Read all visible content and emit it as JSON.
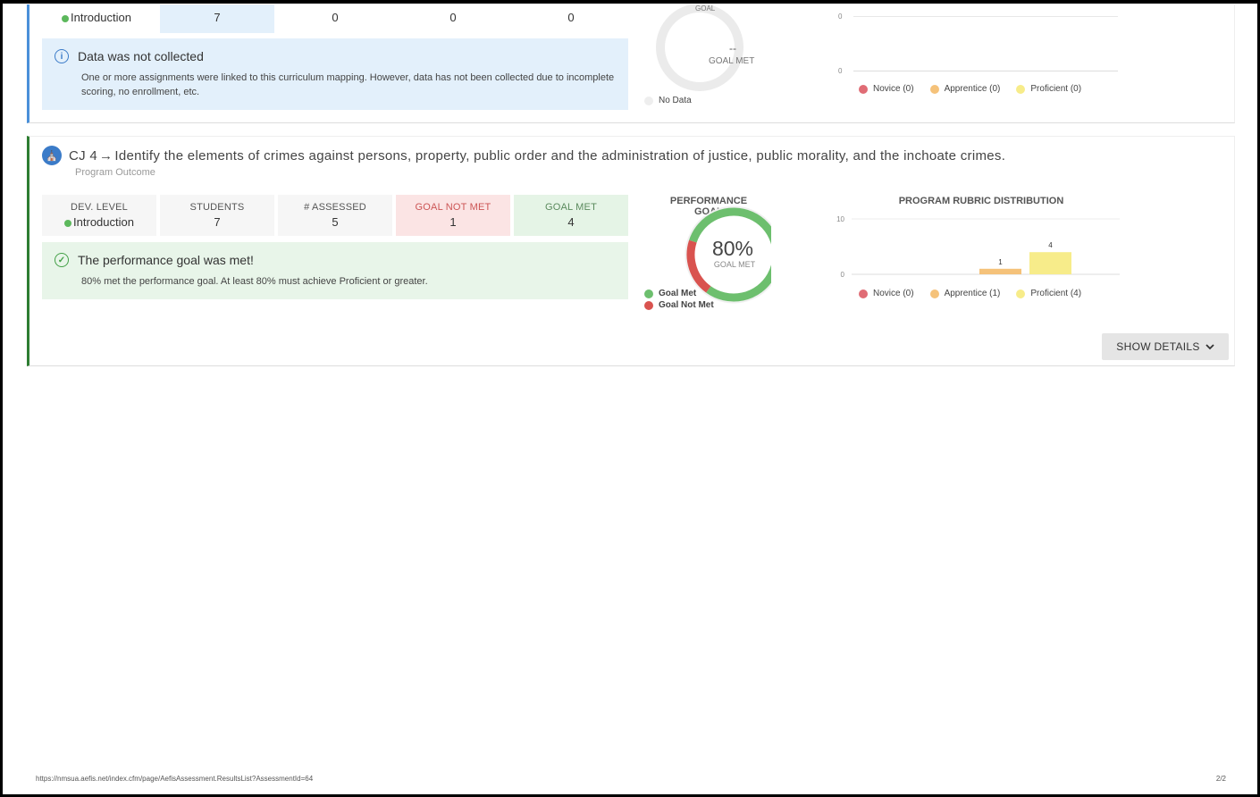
{
  "card_top": {
    "stats": [
      {
        "dev_level": "Introduction"
      },
      {
        "value": "7"
      },
      {
        "value": "0"
      },
      {
        "value": "0"
      },
      {
        "value": "0"
      }
    ],
    "notice": {
      "title": "Data was not collected",
      "body": "One or more assignments were linked to this curriculum mapping. However, data has not been collected due to incomplete scoring, no enrollment, etc."
    },
    "donut": {
      "center_value": "--",
      "center_label": "GOAL MET",
      "legend": "No Data",
      "top_label": "GOAL"
    },
    "rubric": {
      "axis": [
        "0",
        "0"
      ],
      "legend": [
        {
          "label": "Novice (0)",
          "color": "#e06c75"
        },
        {
          "label": "Apprentice (0)",
          "color": "#f5c27a"
        },
        {
          "label": "Proficient (0)",
          "color": "#f7ec8a"
        }
      ]
    }
  },
  "card_main": {
    "code": "CJ 4",
    "arrow": "→",
    "title": "Identify the elements of crimes against persons, property, public order and the administration of justice, public morality, and the inchoate crimes.",
    "subtitle": "Program Outcome",
    "stats": [
      {
        "label": "DEV. LEVEL",
        "dev_level": "Introduction"
      },
      {
        "label": "STUDENTS",
        "value": "7"
      },
      {
        "label": "# ASSESSED",
        "value": "5"
      },
      {
        "label": "GOAL NOT MET",
        "value": "1"
      },
      {
        "label": "GOAL MET",
        "value": "4"
      }
    ],
    "notice": {
      "title": "The performance goal was met!",
      "body": "80% met the performance goal. At least 80% must achieve Proficient or greater."
    },
    "donut": {
      "title_line1": "PERFORMANCE",
      "title_line2": "GOAL",
      "center_value": "80%",
      "center_label": "GOAL MET",
      "legend": [
        {
          "label": "Goal Met",
          "color": "#6dbf6e"
        },
        {
          "label": "Goal Not Met",
          "color": "#d9534f"
        }
      ]
    },
    "show_details": "SHOW DETAILS"
  },
  "chart_data": [
    {
      "type": "pie",
      "title": "PERFORMANCE GOAL",
      "categories": [
        "Goal Met",
        "Goal Not Met"
      ],
      "values": [
        4,
        1
      ],
      "center_text": "80%"
    },
    {
      "type": "bar",
      "title": "PROGRAM RUBRIC DISTRIBUTION",
      "categories": [
        "Novice (0)",
        "Apprentice (1)",
        "Proficient (4)"
      ],
      "values": [
        0,
        1,
        4
      ],
      "colors": [
        "#e06c75",
        "#f5c27a",
        "#f7ec8a"
      ],
      "ylim": [
        0,
        10
      ],
      "yticks": [
        "10",
        "0"
      ],
      "legend": "bottom"
    }
  ],
  "footer": {
    "url": "https://nmsua.aefis.net/index.cfm/page/AefisAssessment.ResultsList?AssessmentId=64",
    "page": "2/2"
  }
}
